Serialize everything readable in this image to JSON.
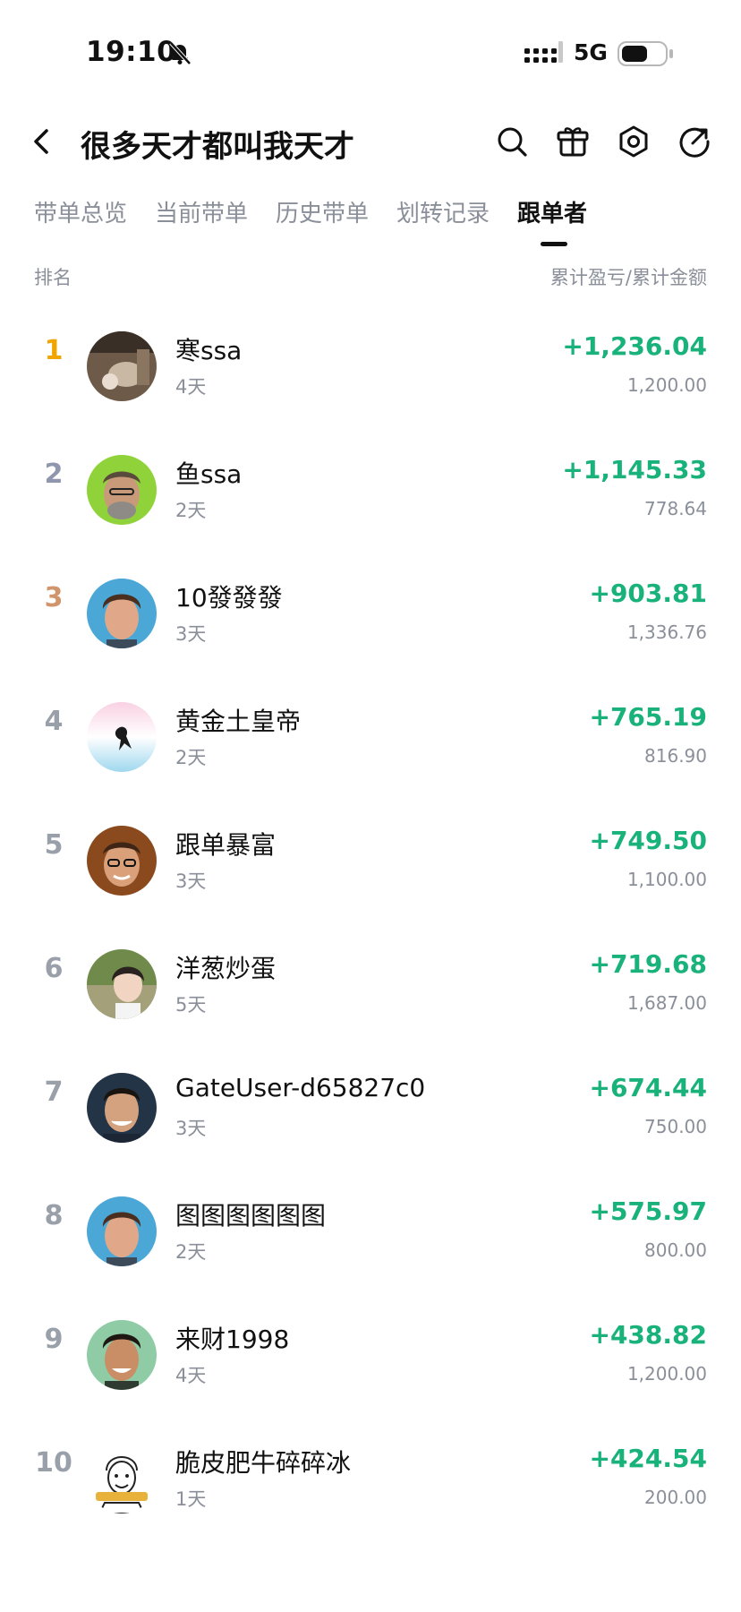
{
  "status_bar": {
    "time": "19:10",
    "network": "5G"
  },
  "header": {
    "title": "很多天才都叫我天才",
    "icons": [
      "search-icon",
      "gift-icon",
      "settings-icon",
      "share-icon"
    ]
  },
  "tabs": [
    {
      "label": "带单总览"
    },
    {
      "label": "当前带单"
    },
    {
      "label": "历史带单"
    },
    {
      "label": "划转记录"
    },
    {
      "label": "跟单者",
      "active": true
    }
  ],
  "columns": {
    "rank": "排名",
    "right": "累计盈亏/累计金额"
  },
  "colors": {
    "profit": "#19b27b",
    "rank_gold": "#f0a500",
    "rank_silver": "#8f96ad",
    "rank_bronze": "#d0956a",
    "rank_default": "#9aa0aa"
  },
  "followers": [
    {
      "rank": "1",
      "name": "寒ssa",
      "days": "4天",
      "pnl": "+1,236.04",
      "amount": "1,200.00"
    },
    {
      "rank": "2",
      "name": "鱼ssa",
      "days": "2天",
      "pnl": "+1,145.33",
      "amount": "778.64"
    },
    {
      "rank": "3",
      "name": "10發發發",
      "days": "3天",
      "pnl": "+903.81",
      "amount": "1,336.76"
    },
    {
      "rank": "4",
      "name": "黄金土皇帝",
      "days": "2天",
      "pnl": "+765.19",
      "amount": "816.90"
    },
    {
      "rank": "5",
      "name": "跟单暴富",
      "days": "3天",
      "pnl": "+749.50",
      "amount": "1,100.00"
    },
    {
      "rank": "6",
      "name": "洋葱炒蛋",
      "days": "5天",
      "pnl": "+719.68",
      "amount": "1,687.00"
    },
    {
      "rank": "7",
      "name": "GateUser-d65827c0",
      "days": "3天",
      "pnl": "+674.44",
      "amount": "750.00"
    },
    {
      "rank": "8",
      "name": "图图图图图图",
      "days": "2天",
      "pnl": "+575.97",
      "amount": "800.00"
    },
    {
      "rank": "9",
      "name": "来财1998",
      "days": "4天",
      "pnl": "+438.82",
      "amount": "1,200.00"
    },
    {
      "rank": "10",
      "name": "脆皮肥牛碎碎冰",
      "days": "1天",
      "pnl": "+424.54",
      "amount": "200.00"
    }
  ]
}
